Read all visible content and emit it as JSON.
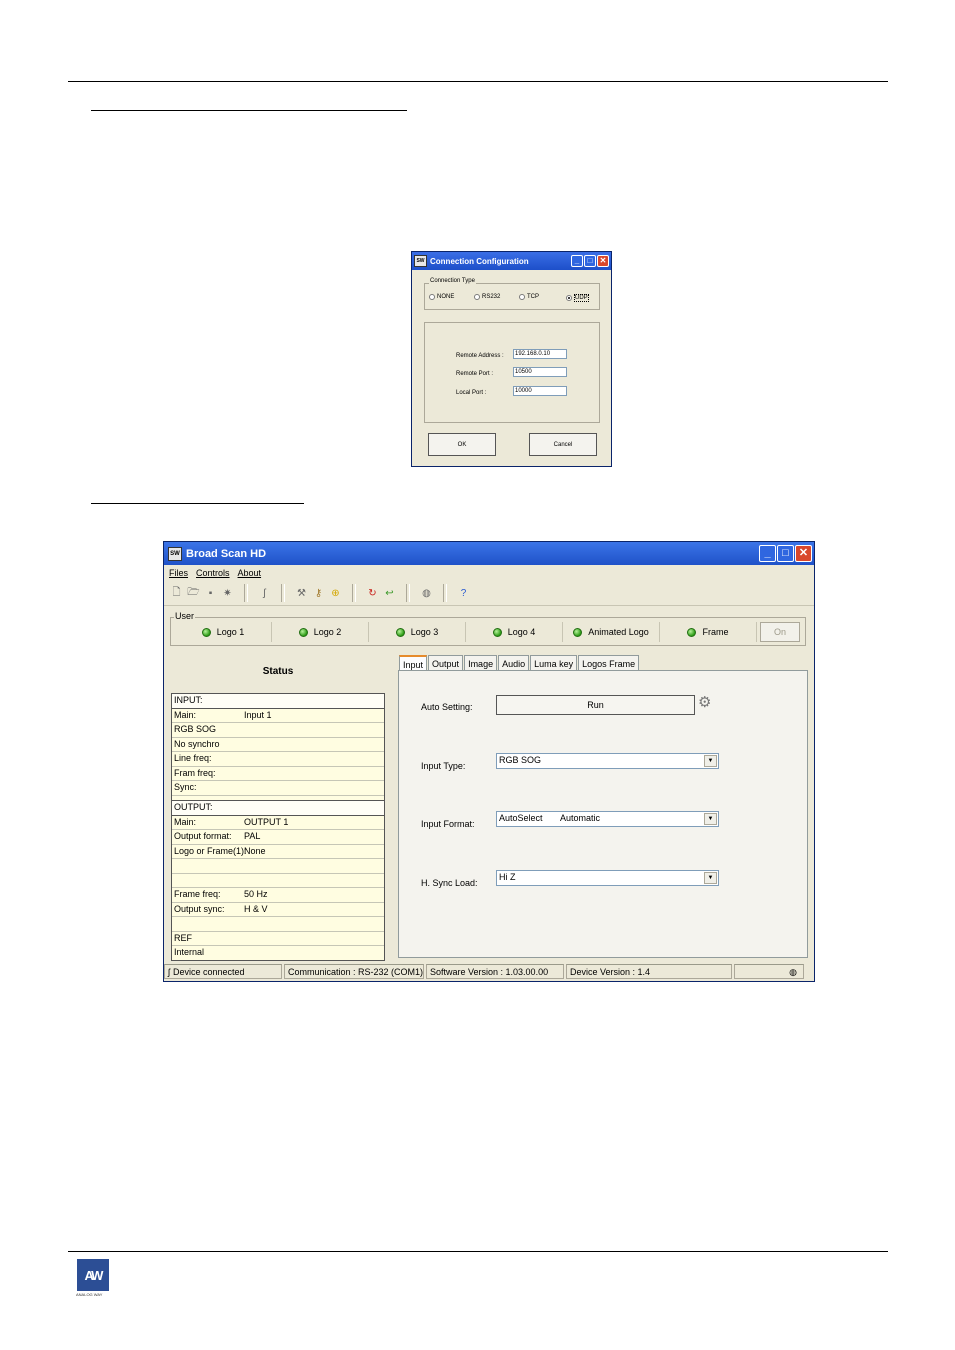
{
  "connection_dialog": {
    "title": "Connection Configuration",
    "group_label": "Connection Type",
    "radios": [
      {
        "label": "NONE",
        "selected": false
      },
      {
        "label": "RS232",
        "selected": false
      },
      {
        "label": "TCP",
        "selected": false
      },
      {
        "label": "UDP",
        "selected": true
      }
    ],
    "fields": [
      {
        "label": "Remote Address :",
        "value": "192.168.0.10"
      },
      {
        "label": "Remote Port :",
        "value": "10500"
      },
      {
        "label": "Local Port :",
        "value": "10000"
      }
    ],
    "ok_label": "OK",
    "cancel_label": "Cancel"
  },
  "main_window": {
    "title": "Broad Scan HD",
    "menu": [
      "Files",
      "Controls",
      "About"
    ],
    "user_group_label": "User",
    "user_buttons": [
      "Logo 1",
      "Logo 2",
      "Logo 3",
      "Logo 4",
      "Animated Logo",
      "Frame"
    ],
    "on_button": "On",
    "status": {
      "title": "Status",
      "input_header": "INPUT:",
      "input_rows": [
        {
          "k": "Main:",
          "v": "Input 1"
        },
        {
          "k": "RGB SOG",
          "v": ""
        },
        {
          "k": "No synchro",
          "v": ""
        },
        {
          "k": "Line freq:",
          "v": ""
        },
        {
          "k": "Fram freq:",
          "v": ""
        },
        {
          "k": "Sync:",
          "v": ""
        },
        {
          "k": "",
          "v": ""
        }
      ],
      "output_header": "OUTPUT:",
      "output_rows": [
        {
          "k": "Main:",
          "v": "OUTPUT 1"
        },
        {
          "k": "Output format:",
          "v": "PAL"
        },
        {
          "k": "Logo or Frame(1):",
          "v": "None"
        },
        {
          "k": "",
          "v": ""
        },
        {
          "k": "",
          "v": ""
        },
        {
          "k": "Frame freq:",
          "v": "50 Hz"
        },
        {
          "k": "Output sync:",
          "v": "H & V"
        },
        {
          "k": "",
          "v": ""
        },
        {
          "k": "REF",
          "v": ""
        },
        {
          "k": "Internal",
          "v": ""
        }
      ]
    },
    "tabs": [
      "Input",
      "Output",
      "Image",
      "Audio",
      "Luma key",
      "Logos Frame"
    ],
    "active_tab": "Input",
    "input_panel": {
      "auto_setting_label": "Auto Setting:",
      "run_label": "Run",
      "input_type_label": "Input Type:",
      "input_type_value": "RGB SOG",
      "input_format_label": "Input Format:",
      "input_format_value": "AutoSelect",
      "input_format_extra": "Automatic",
      "hsync_label": "H. Sync Load:",
      "hsync_value": "Hi Z"
    },
    "statusbar": {
      "connection": "Device connected",
      "communication": "Communication : RS-232 (COM1)",
      "software": "Software Version : 1.03.00.00",
      "device": "Device Version : 1.4"
    }
  },
  "footer": {
    "brand_text": "ANALOG WAY"
  }
}
